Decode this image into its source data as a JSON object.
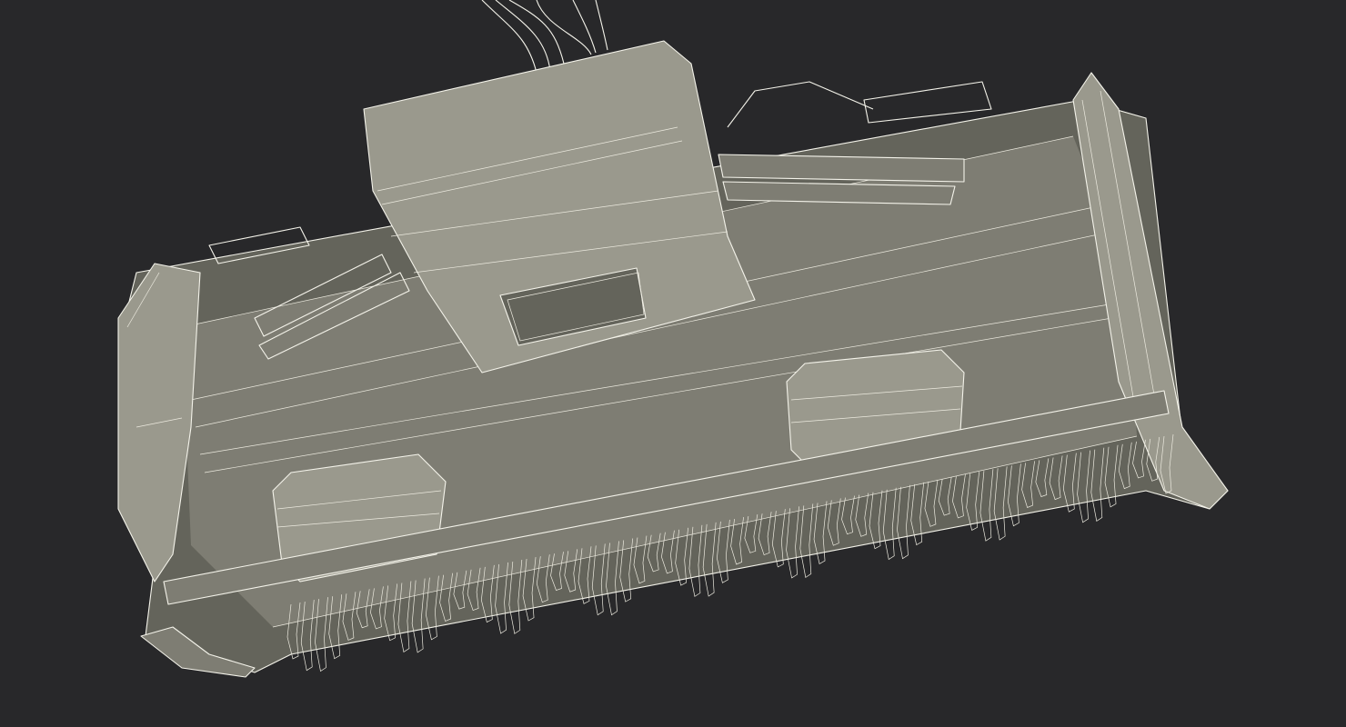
{
  "scene": {
    "subject": "wireframe-3d-render",
    "background_color": "#28282a",
    "surface_color": "#7e7d73",
    "wire_color": "#f4f3ea",
    "object_icon": "forestry-mulcher-model-icon"
  }
}
